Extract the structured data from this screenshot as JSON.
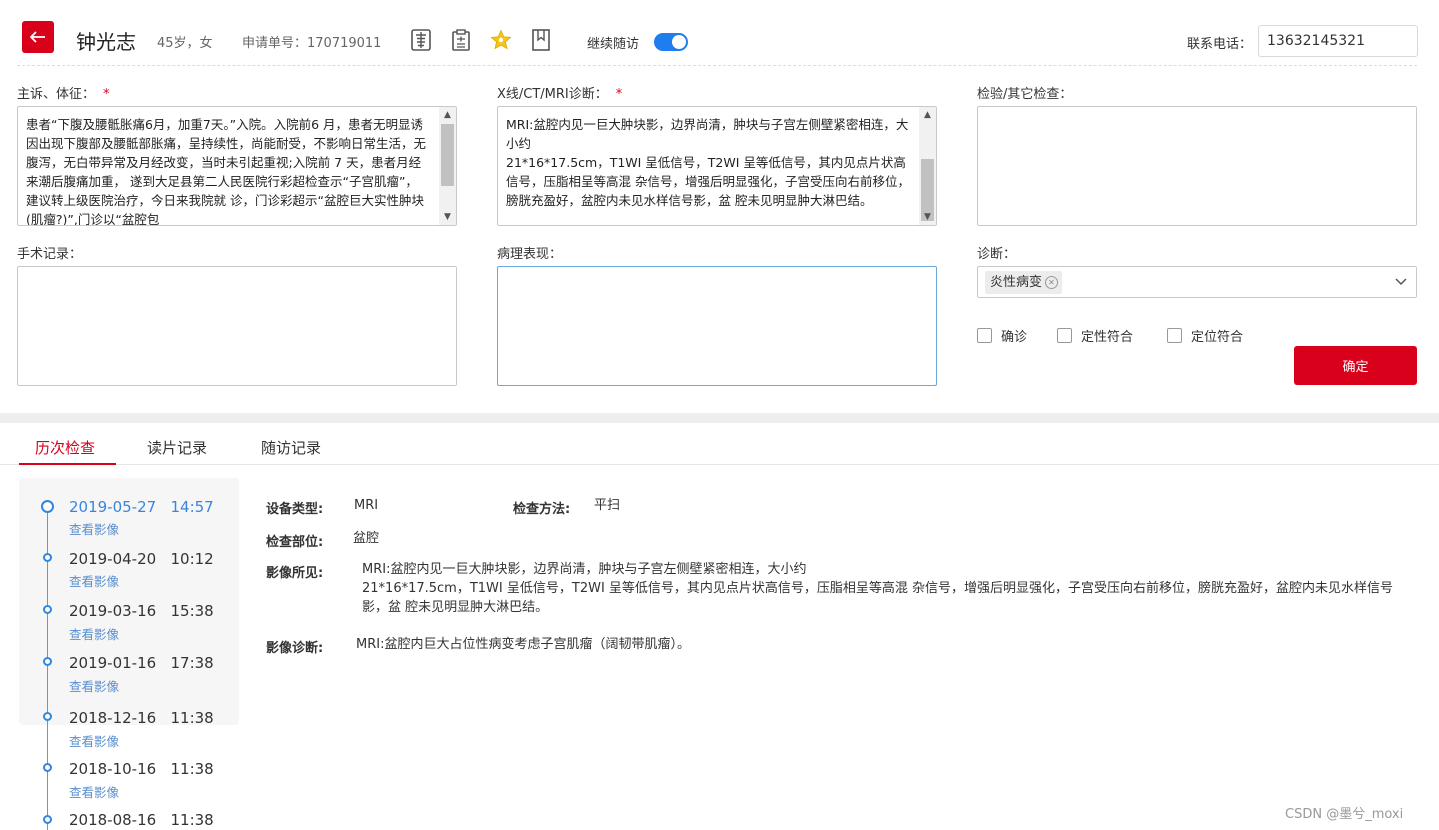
{
  "header": {
    "patient_name": "钟光志",
    "patient_meta": "45岁，女",
    "request_label": "申请单号：170719011",
    "follow_label": "继续随访",
    "phone_label": "联系电话：",
    "phone_value": "13632145321",
    "icons": [
      "xray-icon",
      "clipboard-icon",
      "star-icon",
      "bookmark-icon"
    ]
  },
  "form": {
    "complaint_label": "主诉、体征：",
    "complaint_text": "患者“下腹及腰骶胀痛6月，加重7天。”入院。入院前6 月，患者无明显诱因出现下腹部及腰骶部胀痛，呈持续性，尚能耐受，不影响日常生活，无 腹泻，无白带异常及月经改变，当时未引起重视;入院前 7 天，患者月经来潮后腹痛加重， 遂到大足县第二人民医院行彩超检查示“子宫肌瘤”，建议转上级医院治疗，今日来我院就 诊，门诊彩超示“盆腔巨大实性肿块(肌瘤?)”,门诊以“盆腔包",
    "imaging_label": "X线/CT/MRI诊断：",
    "imaging_text": "MRI:盆腔内见一巨大肿块影，边界尚清，肿块与子宫左侧壁紧密相连，大小约\n21*16*17.5cm，T1WI 呈低信号，T2WI 呈等低信号，其内见点片状高信号，压脂相呈等高混 杂信号，增强后明显强化，子宫受压向右前移位，膀胱充盈好，盆腔内未见水样信号影，盆 腔未见明显肿大淋巴结。",
    "lab_label": "检验/其它检查：",
    "lab_text": "",
    "surgery_label": "手术记录：",
    "surgery_text": "",
    "pathology_label": "病理表现：",
    "pathology_text": "",
    "diagnosis_label": "诊断：",
    "diagnosis_tag": "炎性病变",
    "checkboxes": [
      "确诊",
      "定性符合",
      "定位符合"
    ],
    "confirm_label": "确定"
  },
  "tabs": [
    "历次检查",
    "读片记录",
    "随访记录"
  ],
  "timeline": [
    {
      "date": "2019-05-27   14:57",
      "link": "查看影像",
      "active": true
    },
    {
      "date": "2019-04-20   10:12",
      "link": "查看影像"
    },
    {
      "date": "2019-03-16   15:38",
      "link": "查看影像"
    },
    {
      "date": "2019-01-16   17:38",
      "link": "查看影像"
    },
    {
      "date": "2018-12-16   11:38",
      "link": "查看影像"
    },
    {
      "date": "2018-10-16   11:38",
      "link": "查看影像"
    },
    {
      "date": "2018-08-16   11:38",
      "link": ""
    }
  ],
  "detail": {
    "device_label": "设备类型:",
    "device_value": "MRI",
    "method_label": "检查方法:",
    "method_value": "平扫",
    "part_label": "检查部位:",
    "part_value": "盆腔",
    "findings_label": "影像所见:",
    "findings_value": "MRI:盆腔内见一巨大肿块影，边界尚清，肿块与子宫左侧壁紧密相连，大小约\n21*16*17.5cm，T1WI 呈低信号，T2WI 呈等低信号，其内见点片状高信号，压脂相呈等高混 杂信号，增强后明显强化，子宫受压向右前移位，膀胱充盈好，盆腔内未见水样信号影，盆 腔未见明显肿大淋巴结。",
    "diagnosis_label": "影像诊断:",
    "diagnosis_value": "MRI:盆腔内巨大占位性病变考虑子宫肌瘤（阔韧带肌瘤）。"
  },
  "watermark": "CSDN @墨兮_moxi",
  "colors": {
    "accent": "#d9001b",
    "link": "#3a85dc",
    "toggle": "#1e7ef0"
  }
}
